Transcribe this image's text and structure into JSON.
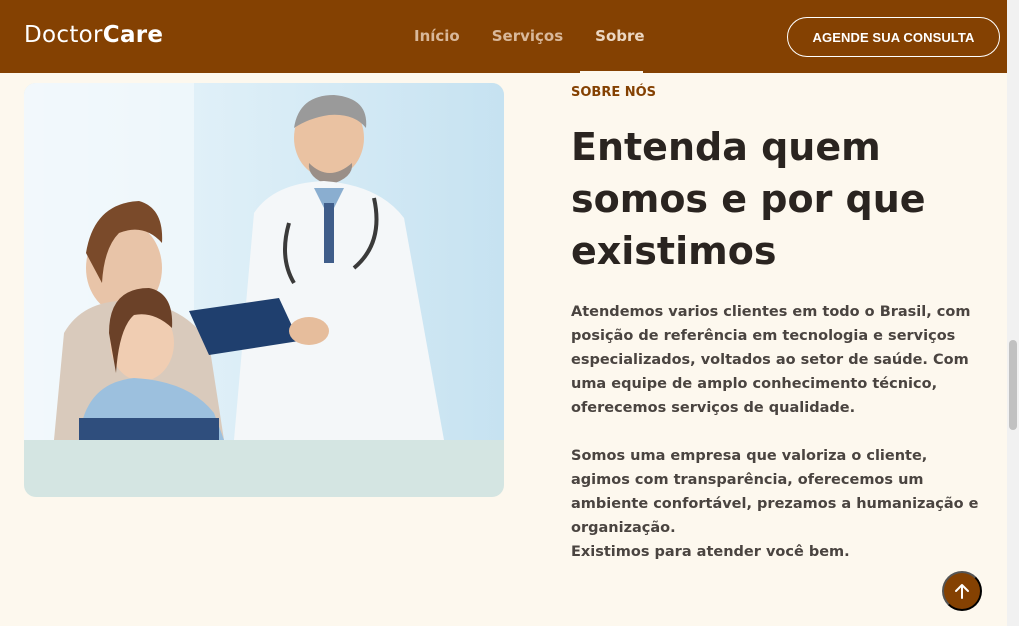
{
  "brand": {
    "name_regular": "Doctor",
    "name_bold": "Care"
  },
  "nav": {
    "items": [
      {
        "label": "Início"
      },
      {
        "label": "Serviços"
      },
      {
        "label": "Sobre"
      }
    ],
    "active": "Sobre"
  },
  "header": {
    "cta_label": "AGENDE SUA CONSULTA"
  },
  "about": {
    "kicker": "SOBRE NÓS",
    "title": "Entenda quem somos e por que existimos",
    "paragraphs": [
      "Atendemos varios clientes em todo o Brasil, com posição de referência em tecnologia e serviços especializados, voltados ao setor de saúde. Com uma equipe de amplo conhecimento técnico, oferecemos serviços de qualidade.",
      "Somos uma empresa que valoriza o cliente, agimos com transparência, oferecemos um ambiente confortável, prezamos a humanização e organização.",
      "Existimos para atender você bem."
    ]
  },
  "icons": {
    "scroll_top": "arrow-up-icon"
  },
  "colors": {
    "brand": "#844102",
    "background": "#fdf8ee",
    "card_bottom": "#d4e5e2"
  }
}
